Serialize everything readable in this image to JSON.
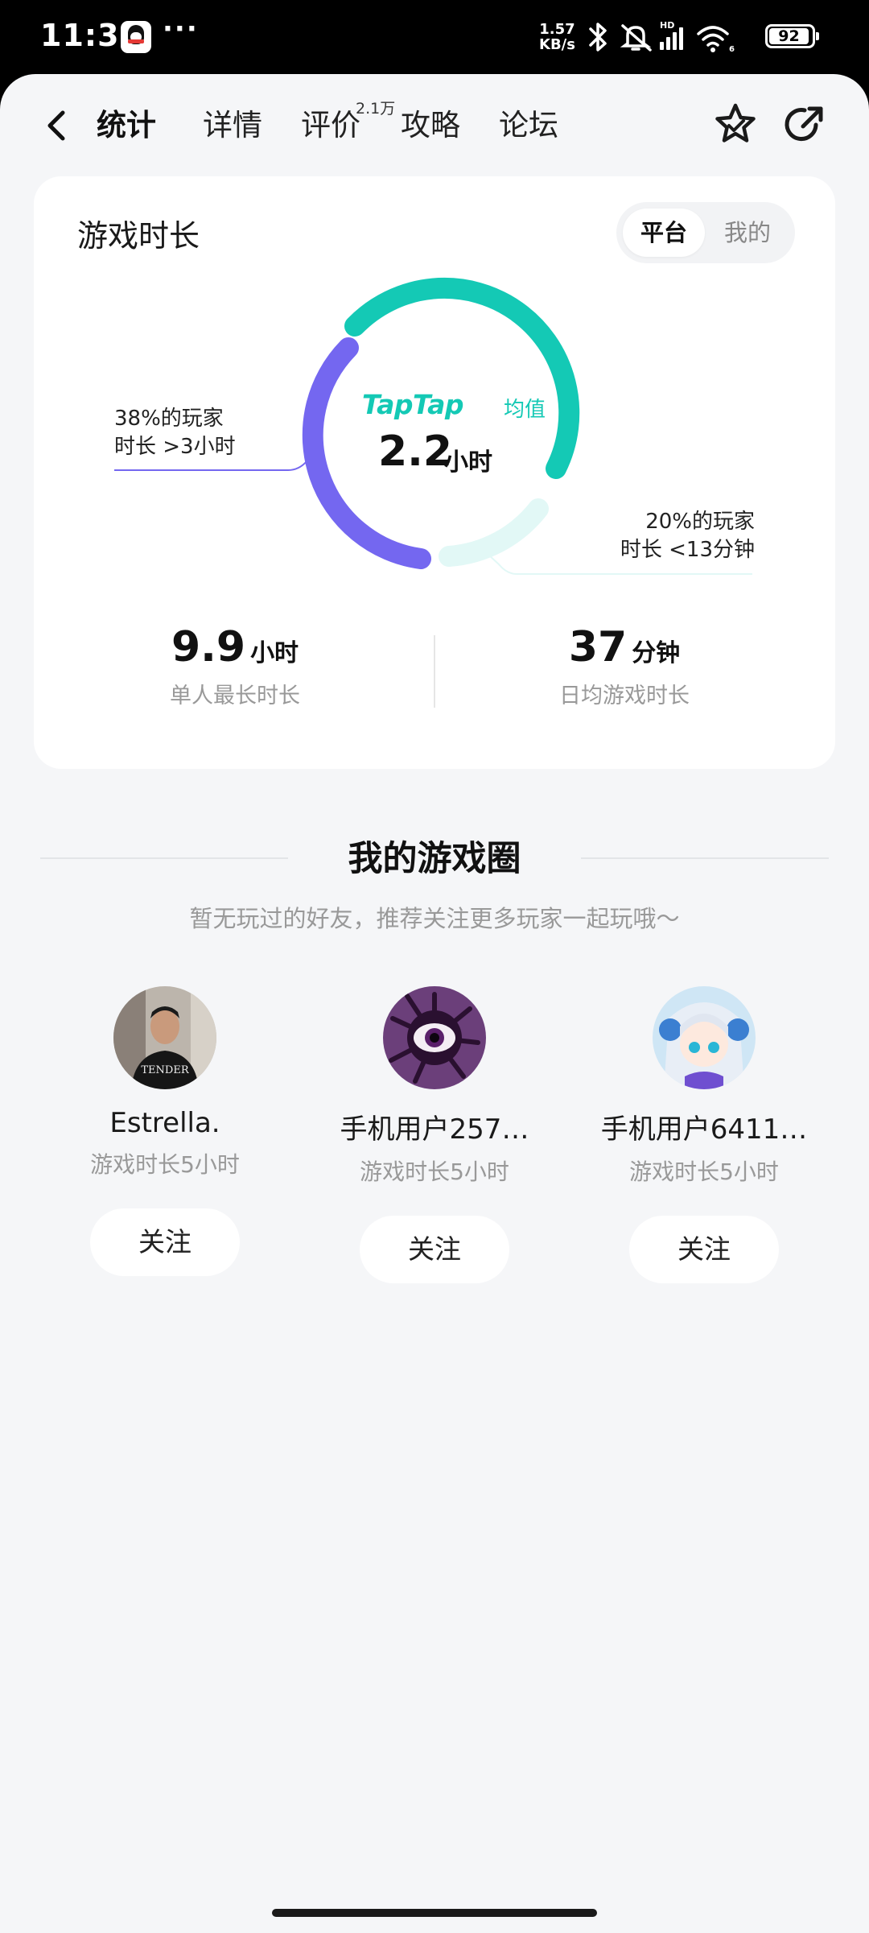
{
  "status_bar": {
    "time": "11:39",
    "more": "···",
    "net_speed_value": "1.57",
    "net_speed_unit": "KB/s",
    "battery": "92"
  },
  "nav": {
    "tabs": [
      {
        "label": "统计"
      },
      {
        "label": "详情"
      },
      {
        "label": "评价"
      },
      {
        "label": "攻略"
      },
      {
        "label": "论坛"
      }
    ],
    "review_badge": "2.1万"
  },
  "playtime": {
    "title": "游戏时长",
    "toggle": {
      "platform": "平台",
      "mine": "我的"
    },
    "brand": "TapTap",
    "avg_label": "均值",
    "avg_value": "2.2",
    "avg_unit": "小时",
    "left_label_line1": "38%的玩家",
    "left_label_line2": "时长 >3小时",
    "right_label_line1": "20%的玩家",
    "right_label_line2": "时长 <13分钟",
    "donut_colors": {
      "long": "#7467f0",
      "mid": "#14c9b5",
      "short": "#e2f8f6"
    },
    "max_value": "9.9",
    "max_unit": "小时",
    "max_label": "单人最长时长",
    "daily_value": "37",
    "daily_unit": "分钟",
    "daily_label": "日均游戏时长"
  },
  "circle": {
    "title": "我的游戏圈",
    "subtitle": "暂无玩过的好友，推荐关注更多玩家一起玩哦～",
    "friends": [
      {
        "name": "Estrella.",
        "playtime": "游戏时长5小时",
        "follow": "关注"
      },
      {
        "name": "手机用户257…",
        "playtime": "游戏时长5小时",
        "follow": "关注"
      },
      {
        "name": "手机用户6411…",
        "playtime": "游戏时长5小时",
        "follow": "关注"
      }
    ]
  }
}
